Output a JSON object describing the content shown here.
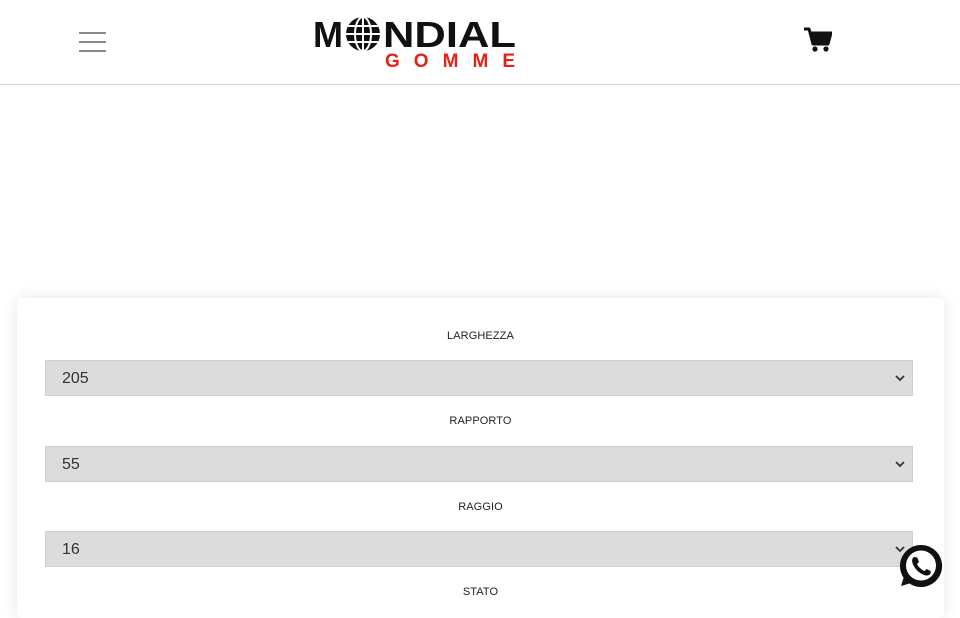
{
  "header": {
    "menu_icon": "hamburger-menu-icon",
    "logo": {
      "line1": "MONDIAL",
      "line2": "GOMME"
    },
    "cart_icon": "shopping-cart-icon"
  },
  "form": {
    "fields": [
      {
        "label": "LARGHEZZA",
        "value": "205"
      },
      {
        "label": "RAPPORTO",
        "value": "55"
      },
      {
        "label": "RAGGIO",
        "value": "16"
      },
      {
        "label": "STATO",
        "value": ""
      }
    ]
  },
  "floating": {
    "whatsapp_icon": "whatsapp-icon"
  },
  "colors": {
    "logo_red": "#e2231a",
    "logo_black": "#111111",
    "select_bg": "#dcdcdc"
  }
}
